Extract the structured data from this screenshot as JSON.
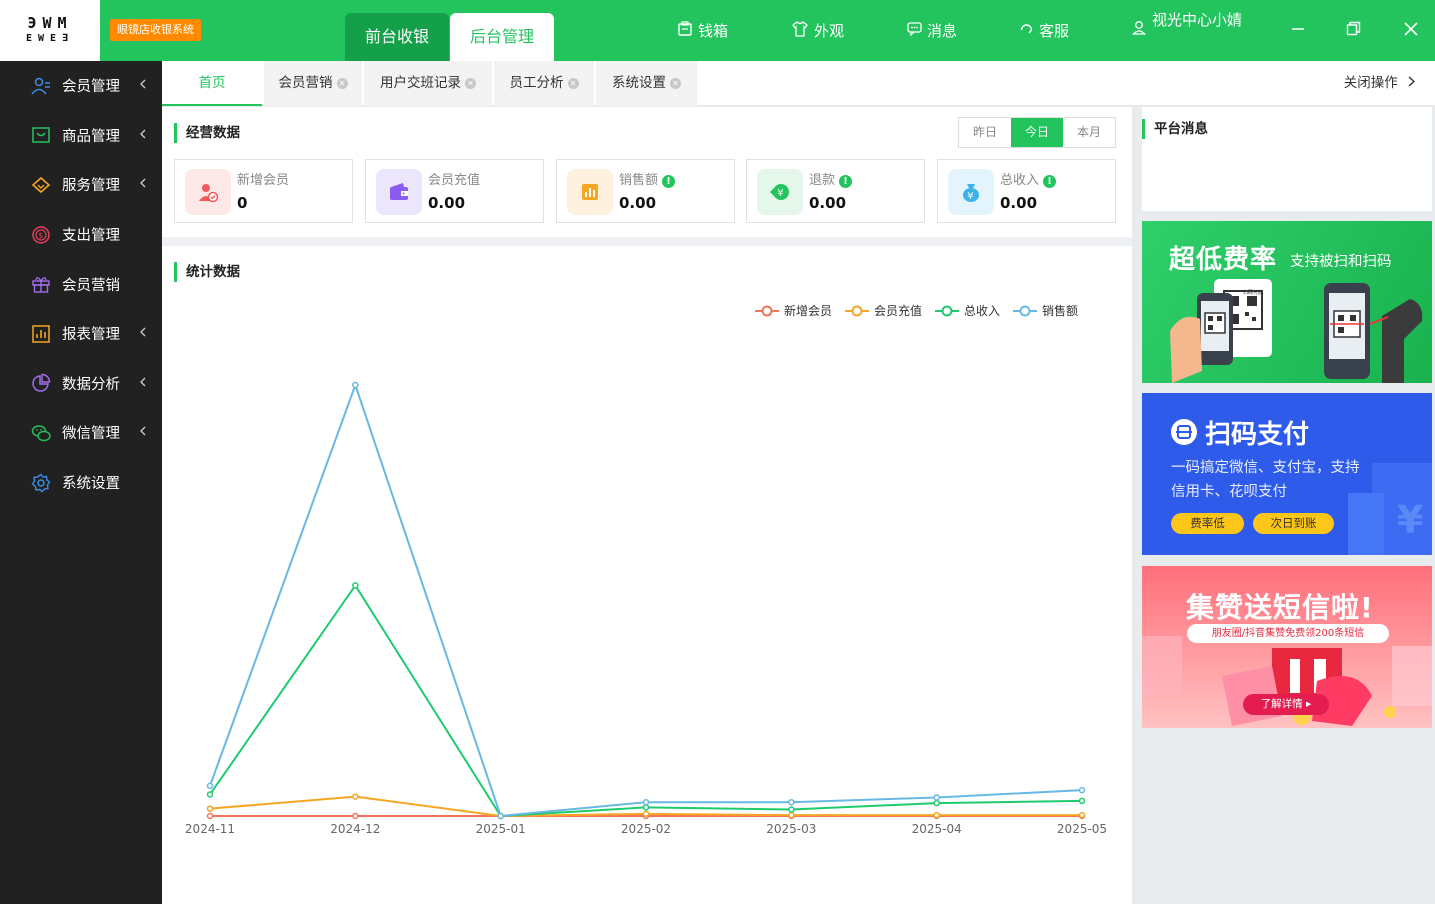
{
  "topbar": {
    "brand_tag": "眼镜店收银系统",
    "modes": [
      "前台收银",
      "后台管理"
    ],
    "nav": [
      {
        "label": "钱箱",
        "icon": "cash-box-icon"
      },
      {
        "label": "外观",
        "icon": "shirt-icon"
      },
      {
        "label": "消息",
        "icon": "message-icon"
      },
      {
        "label": "客服",
        "icon": "headset-icon"
      }
    ],
    "user_name": "视光中心小婧"
  },
  "sidebar": {
    "items": [
      {
        "label": "会员管理",
        "icon": "members-icon",
        "color": "#3a8ee6",
        "expandable": true
      },
      {
        "label": "商品管理",
        "icon": "goods-icon",
        "color": "#23c45e",
        "expandable": true
      },
      {
        "label": "服务管理",
        "icon": "service-icon",
        "color": "#f5a623",
        "expandable": true
      },
      {
        "label": "支出管理",
        "icon": "expense-icon",
        "color": "#e83e58",
        "expandable": false
      },
      {
        "label": "会员营销",
        "icon": "gift-icon",
        "color": "#a46cf0",
        "expandable": false
      },
      {
        "label": "报表管理",
        "icon": "report-icon",
        "color": "#f5a623",
        "expandable": true
      },
      {
        "label": "数据分析",
        "icon": "pie-chart-icon",
        "color": "#a46cf0",
        "expandable": true
      },
      {
        "label": "微信管理",
        "icon": "wechat-icon",
        "color": "#23c45e",
        "expandable": true
      },
      {
        "label": "系统设置",
        "icon": "settings-icon",
        "color": "#3a8ee6",
        "expandable": false
      }
    ]
  },
  "tabs": {
    "home": "首页",
    "open": [
      "会员营销",
      "用户交班记录",
      "员工分析",
      "系统设置"
    ],
    "close_ops": "关闭操作"
  },
  "business": {
    "title": "经营数据",
    "ranges": [
      "昨日",
      "今日",
      "本月"
    ],
    "active_range": "今日",
    "cards": [
      {
        "label": "新增会员",
        "value": "0",
        "info": false,
        "icon": "new-member-icon",
        "bg": "#fde8e8",
        "color": "#f25b5b"
      },
      {
        "label": "会员充值",
        "value": "0.00",
        "info": false,
        "icon": "wallet-icon",
        "bg": "#ece6fd",
        "color": "#8a5cf0"
      },
      {
        "label": "销售额",
        "value": "0.00",
        "info": true,
        "icon": "sales-icon",
        "bg": "#fff1e0",
        "color": "#f5a623"
      },
      {
        "label": "退款",
        "value": "0.00",
        "info": true,
        "icon": "refund-icon",
        "bg": "#e4f7ea",
        "color": "#23c45e"
      },
      {
        "label": "总收入",
        "value": "0.00",
        "info": true,
        "icon": "income-icon",
        "bg": "#e3f4fc",
        "color": "#3bb3e6"
      }
    ]
  },
  "stats": {
    "title": "统计数据"
  },
  "chart_data": {
    "type": "line",
    "categories": [
      "2024-11",
      "2024-12",
      "2025-01",
      "2025-02",
      "2025-03",
      "2025-04",
      "2025-05"
    ],
    "ylim": [
      0,
      1000
    ],
    "grid": false,
    "legend": "top-right",
    "series": [
      {
        "name": "新增会员",
        "color": "#f0735a",
        "values": [
          0,
          0,
          0,
          0,
          0,
          0,
          0
        ]
      },
      {
        "name": "会员充值",
        "color": "#f5a623",
        "values": [
          17,
          45,
          0,
          5,
          2,
          2,
          2
        ]
      },
      {
        "name": "总收入",
        "color": "#1fcb6e",
        "values": [
          50,
          535,
          0,
          20,
          15,
          30,
          35
        ]
      },
      {
        "name": "销售额",
        "color": "#67b8e3",
        "values": [
          70,
          1000,
          0,
          32,
          32,
          43,
          60
        ]
      }
    ]
  },
  "right_panel": {
    "platform_msg_title": "平台消息",
    "banner1": {
      "title": "超低费率",
      "subtitle": "支持被扫和扫码",
      "screen_label": "扫码付款"
    },
    "banner2": {
      "title": "扫码支付",
      "line1": "一码搞定微信、支付宝，支持",
      "line2": "信用卡、花呗支付",
      "btn1": "费率低",
      "btn2": "次日到账"
    },
    "banner3": {
      "title": "集赞送短信啦!",
      "subtitle": "朋友圈/抖音集赞免费领200条短信",
      "btn": "了解详情"
    }
  }
}
